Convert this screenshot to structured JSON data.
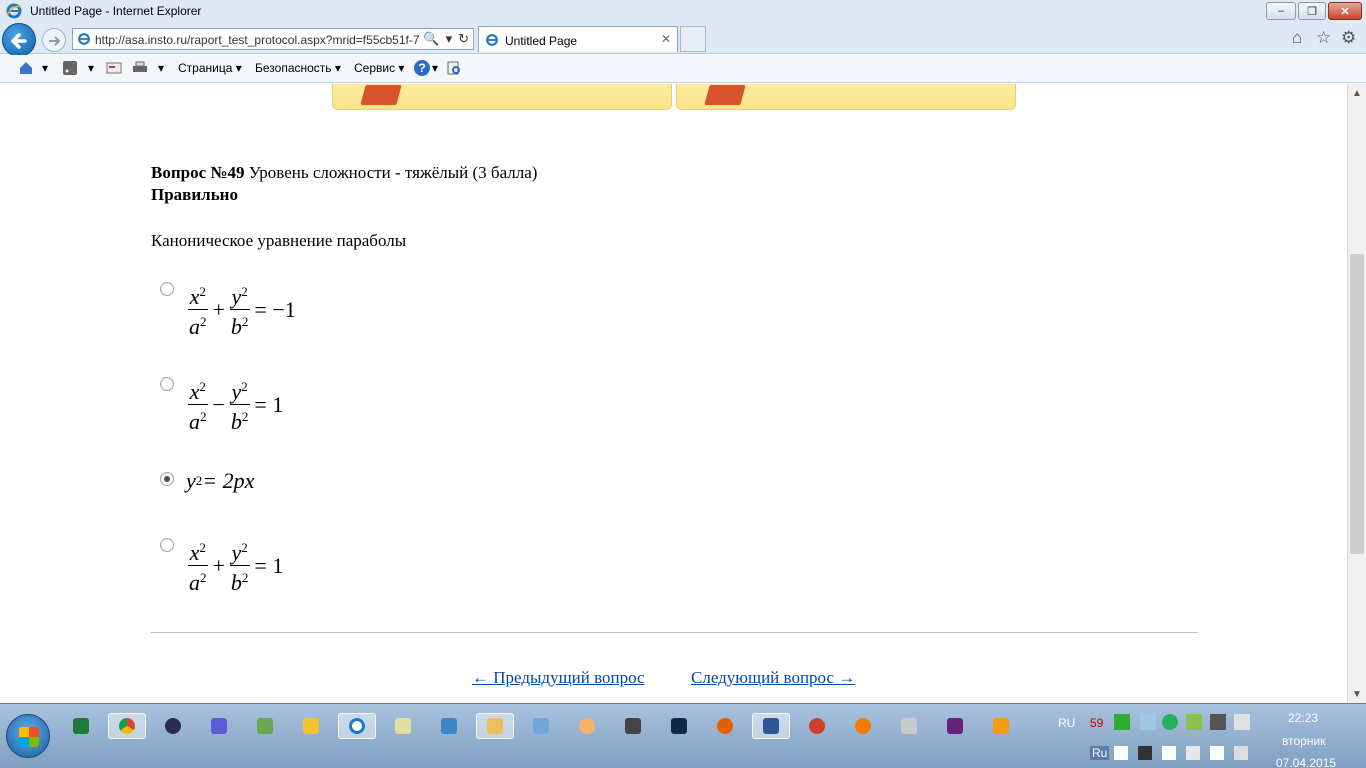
{
  "window": {
    "title": "Untitled Page - Internet Explorer",
    "min_label": "–",
    "max_label": "❐",
    "close_label": "✕"
  },
  "navbar": {
    "url": "http://asa.insto.ru/raport_test_protocol.aspx?mrid=f55cb51f-7",
    "search_icon": "🔍",
    "dropdown_icon": "▾",
    "refresh_icon": "↻",
    "tab_label": "Untitled Page",
    "tab_close": "✕",
    "home_icon": "⌂",
    "favorites_icon": "☆",
    "tools_icon": "⚙"
  },
  "commandbar": {
    "page_menu": "Страница ▾",
    "security_menu": "Безопасность ▾",
    "service_menu": "Сервис ▾",
    "help_icon": "?"
  },
  "question": {
    "number_label": "Вопрос №49",
    "difficulty": " Уровень сложности - тяжёлый (3 балла)",
    "status": "Правильно",
    "text": "Каноническое уравнение параболы",
    "options": [
      {
        "checked": false
      },
      {
        "checked": false
      },
      {
        "checked": true
      },
      {
        "checked": false
      }
    ],
    "math": {
      "x": "x",
      "y": "y",
      "a": "a",
      "b": "b",
      "exp": "2",
      "plus": "+",
      "minus": "−",
      "eq_neg1": "= −1",
      "eq_1": "= 1",
      "opt3_y": "y",
      "opt3_rest": " = 2px"
    }
  },
  "navigation": {
    "prev": "← Предыдущий вопрос",
    "next": "Следующий вопрос →"
  },
  "tray": {
    "lang_top": "RU",
    "badge": "59",
    "lang_bottom": "Ru",
    "time": "22:23",
    "day": "вторник",
    "date": "07.04.2015"
  },
  "colors": {
    "link": "#0645ad",
    "banner": "#fce489",
    "taskbar": "#7f9fc2"
  }
}
